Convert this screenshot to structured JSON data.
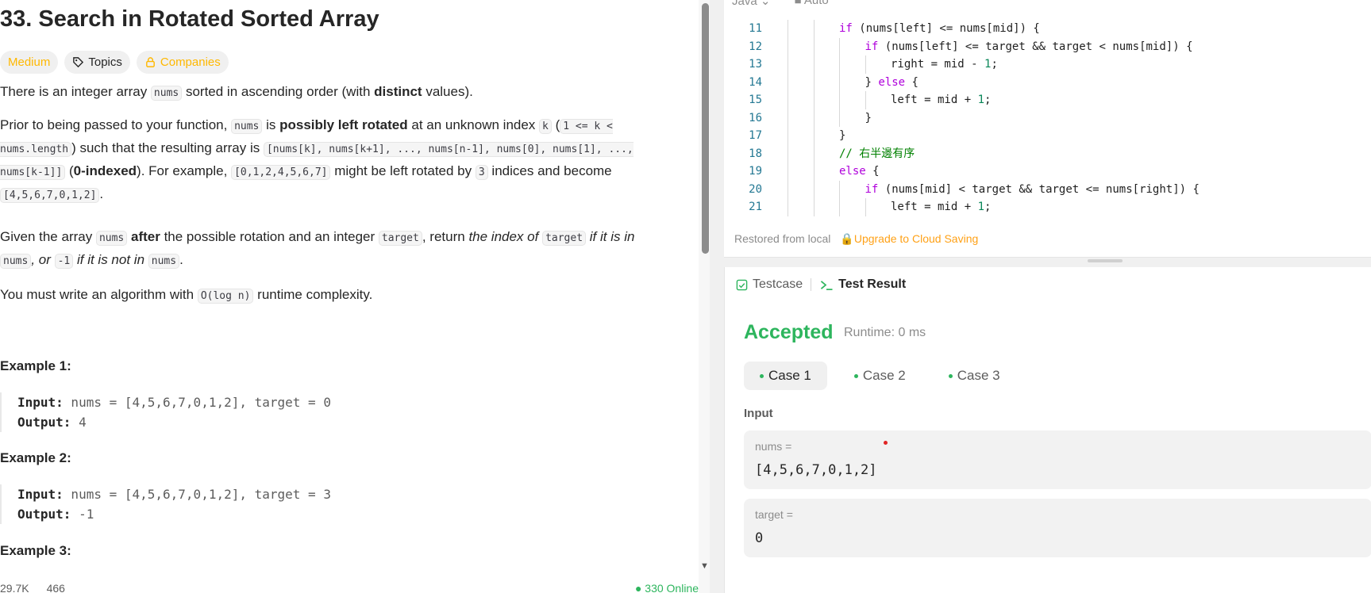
{
  "problem": {
    "title": "33. Search in Rotated Sorted Array",
    "tags": {
      "difficulty": "Medium",
      "topics": "Topics",
      "companies": "Companies"
    },
    "p1": {
      "t1": "There is an integer array ",
      "c1": "nums",
      "t2": " sorted in ascending order (with ",
      "b1": "distinct",
      "t3": " values)."
    },
    "p2": {
      "t1": "Prior to being passed to your function, ",
      "c1": "nums",
      "t2": " is ",
      "b1": "possibly left rotated",
      "t3": " at an unknown index ",
      "c2": "k",
      "t4": " (",
      "c3": "1 <= k < nums.length",
      "t5": ") such that the resulting array is ",
      "c4": "[nums[k], nums[k+1], ..., nums[n-1], nums[0], nums[1], ..., nums[k-1]]",
      "t6": " (",
      "b2": "0-indexed",
      "t7": "). For example, ",
      "c5": "[0,1,2,4,5,6,7]",
      "t8": " might be left rotated by ",
      "c6": "3",
      "t9": " indices and become ",
      "c7": "[4,5,6,7,0,1,2]",
      "t10": "."
    },
    "p3": {
      "t1": "Given the array ",
      "c1": "nums",
      "b1": " after",
      "t2": " the possible rotation and an integer ",
      "c2": "target",
      "t3": ", return ",
      "i1": "the index of ",
      "c3": "target",
      "i2": " if it is in ",
      "c4": "nums",
      "i3": ", or ",
      "c5": "-1",
      "i4": " if it is not in ",
      "c6": "nums",
      "t4": "."
    },
    "p4": {
      "t1": "You must write an algorithm with ",
      "c1": "O(log n)",
      "t2": " runtime complexity."
    },
    "examples": [
      {
        "title": "Example 1:",
        "input_label": "Input:",
        "input": " nums = [4,5,6,7,0,1,2], target = 0",
        "output_label": "Output:",
        "output": " 4"
      },
      {
        "title": "Example 2:",
        "input_label": "Input:",
        "input": " nums = [4,5,6,7,0,1,2], target = 3",
        "output_label": "Output:",
        "output": " -1"
      },
      {
        "title": "Example 3:"
      }
    ],
    "footer": {
      "likes": "29.7K",
      "comments": "466",
      "online": "● 330 Online"
    }
  },
  "editor": {
    "language": "Java",
    "mode": "Auto",
    "restored": "Restored from local",
    "upgrade": "Upgrade to Cloud Saving"
  },
  "code": [
    {
      "n": "11",
      "indent": 2,
      "html": "<span class=\"kw\">if</span> (nums[left] &lt;= nums[mid]) {"
    },
    {
      "n": "12",
      "indent": 3,
      "html": "<span class=\"kw\">if</span> (nums[left] &lt;= target &amp;&amp; target &lt; nums[mid]) {"
    },
    {
      "n": "13",
      "indent": 4,
      "html": "right = mid - <span class=\"num\">1</span>;"
    },
    {
      "n": "14",
      "indent": 3,
      "html": "} <span class=\"kw\">else</span> {"
    },
    {
      "n": "15",
      "indent": 4,
      "html": "left = mid + <span class=\"num\">1</span>;"
    },
    {
      "n": "16",
      "indent": 3,
      "html": "}"
    },
    {
      "n": "17",
      "indent": 2,
      "html": "}"
    },
    {
      "n": "18",
      "indent": 2,
      "html": "<span class=\"cm\">// 右半邊有序</span>"
    },
    {
      "n": "19",
      "indent": 2,
      "html": "<span class=\"kw\">else</span> {"
    },
    {
      "n": "20",
      "indent": 3,
      "html": "<span class=\"kw\">if</span> (nums[mid] &lt; target &amp;&amp; target &lt;= nums[right]) {"
    },
    {
      "n": "21",
      "indent": 4,
      "html": "left = mid + <span class=\"num\">1</span>;"
    }
  ],
  "result": {
    "tab_testcase": "Testcase",
    "tab_result": "Test Result",
    "status": "Accepted",
    "runtime": "Runtime: 0 ms",
    "cases": [
      "Case 1",
      "Case 2",
      "Case 3"
    ],
    "input_label": "Input",
    "inputs": [
      {
        "name": "nums =",
        "value": "[4,5,6,7,0,1,2]"
      },
      {
        "name": "target =",
        "value": "0"
      }
    ]
  },
  "colors": {
    "accepted": "#2db55d",
    "medium": "#ffb800",
    "upgrade": "#ffa116"
  }
}
